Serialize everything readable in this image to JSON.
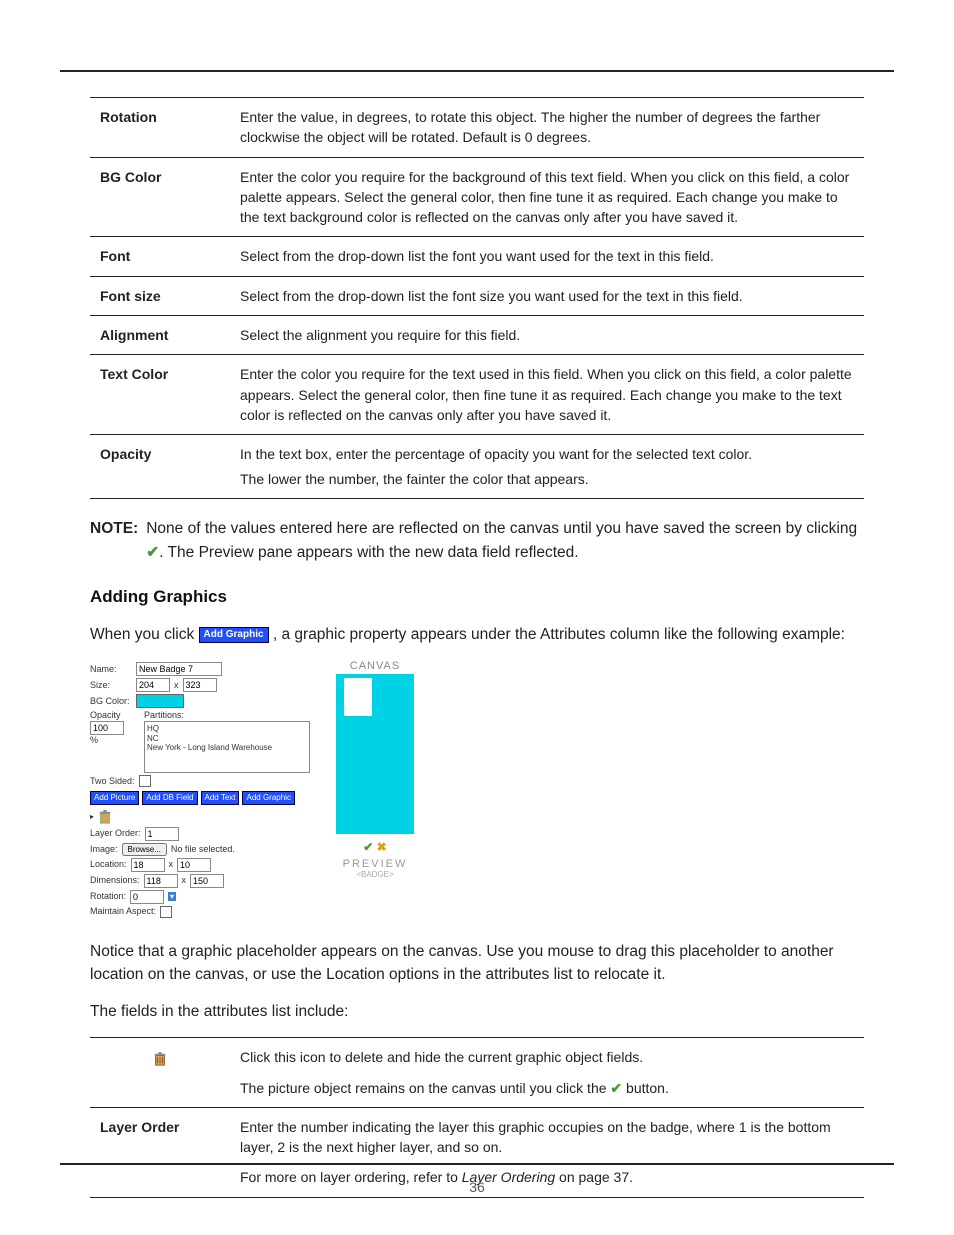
{
  "page_number": "36",
  "table1": {
    "rows": [
      {
        "k": "Rotation",
        "v": "Enter the value, in degrees, to rotate this object. The higher the number of degrees the farther clockwise the object will be rotated. Default is 0 degrees."
      },
      {
        "k": "BG Color",
        "v": "Enter the color you require for the background of this text field. When you click on this field, a color palette appears. Select the general color, then fine tune it as required. Each change you make to the text background color is reflected on the canvas only after you have saved it."
      },
      {
        "k": "Font",
        "v": "Select from the drop-down list the font you want used for the text in this field."
      },
      {
        "k": "Font size",
        "v": "Select from the drop-down list the font size you want used for the text in this field."
      },
      {
        "k": "Alignment",
        "v": "Select the alignment you require for this field."
      },
      {
        "k": "Text Color",
        "v": "Enter the color you require for the text used in this field. When you click on this field, a color palette appears. Select the general color, then fine tune it as required. Each change you make to the text color is reflected on the canvas only after you have saved it."
      },
      {
        "k": "Opacity",
        "v1": "In the text box, enter the percentage of opacity you want for the selected text color.",
        "v2": "The lower the number, the fainter the color that appears."
      }
    ]
  },
  "note": {
    "label": "NOTE:",
    "body_a": "None of the values entered here are reflected on the canvas until you have saved the screen by clicking ",
    "body_b": ". The Preview pane appears with the new data field reflected."
  },
  "heading": "Adding Graphics",
  "para1_a": "When you click  ",
  "para1_b": " , a graphic property appears under the Attributes column like the following example:",
  "add_graphic_btn": "Add Graphic",
  "figure": {
    "name_lbl": "Name:",
    "name_val": "New Badge 7",
    "size_lbl": "Size:",
    "size_w": "204",
    "size_h": "323",
    "bgcolor_lbl": "BG Color:",
    "opacity_lbl": "Opacity",
    "opacity_val": "100",
    "opacity_unit": "%",
    "partitions_lbl": "Partitions:",
    "partitions": [
      "HQ",
      "NC",
      "New York - Long Island Warehouse"
    ],
    "two_sided_lbl": "Two Sided:",
    "buttons": [
      "Add Picture",
      "Add DB Field",
      "Add Text",
      "Add Graphic"
    ],
    "layer_lbl": "Layer Order:",
    "layer_val": "1",
    "image_lbl": "Image:",
    "browse": "Browse...",
    "no_file": "No file selected.",
    "location_lbl": "Location:",
    "loc_x": "18",
    "loc_y": "10",
    "dimensions_lbl": "Dimensions:",
    "dim_w": "118",
    "dim_h": "150",
    "rotation_lbl": "Rotation:",
    "rotation_val": "0",
    "maintain_lbl": "Maintain Aspect:",
    "canvas_label": "CANVAS",
    "preview_label": "PREVIEW",
    "badge_tag": "<BADGE>"
  },
  "para2": "Notice that a graphic placeholder appears on the canvas. Use you mouse to drag this placeholder to another location on the canvas, or use the Location options in the attributes list to relocate it.",
  "para3": "The fields in the attributes list include:",
  "table2": {
    "r1_a": "Click this icon to delete and hide the current graphic object fields.",
    "r1_b_a": "The picture object remains on the canvas until you click the ",
    "r1_b_b": " button.",
    "r2_k": "Layer Order",
    "r2_a": "Enter the number indicating the layer this graphic occupies on the badge, where 1 is the bottom layer, 2 is the next higher layer, and so on.",
    "r2_b_a": "For more on layer ordering, refer to ",
    "r2_b_link": "Layer Ordering",
    "r2_b_b": " on page 37."
  }
}
